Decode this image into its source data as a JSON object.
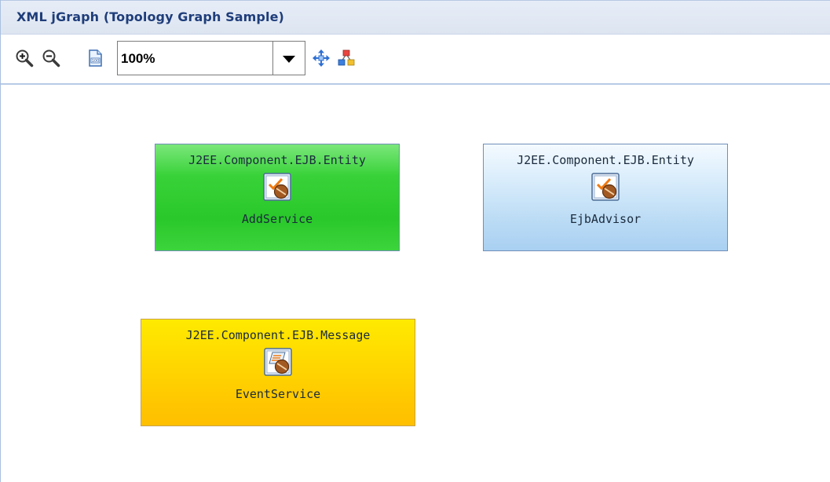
{
  "window": {
    "title": "XML jGraph (Topology Graph Sample)"
  },
  "toolbar": {
    "zoom_in_icon": "zoom-in-icon",
    "zoom_out_icon": "zoom-out-icon",
    "actual_size_icon": "actual-size-icon",
    "zoom_value": "100%",
    "fit_icon": "fit-to-window-icon",
    "layout_icon": "layout-icon"
  },
  "nodes": [
    {
      "type": "J2EE.Component.EJB.Entity",
      "name": "AddService",
      "color": "#2ac82a",
      "icon": "ejb-entity-icon"
    },
    {
      "type": "J2EE.Component.EJB.Entity",
      "name": "EjbAdvisor",
      "color": "#bcdcf5",
      "icon": "ejb-entity-icon"
    },
    {
      "type": "J2EE.Component.EJB.Message",
      "name": "EventService",
      "color": "#ffd000",
      "icon": "ejb-message-icon"
    }
  ]
}
